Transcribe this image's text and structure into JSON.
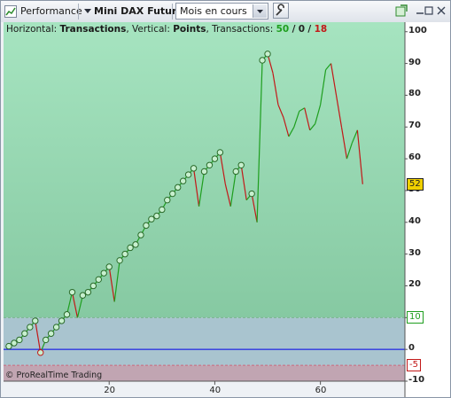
{
  "toolbar": {
    "perf_label": "Performance",
    "instrument_label": "Mini DAX Future",
    "period_value": "Mois en cours"
  },
  "info": {
    "prefix": "Horizontal: ",
    "h_value": "Transactions",
    "mid": ", Vertical: ",
    "v_value": "Points",
    "tx_label": ", Transactions: ",
    "wins": "50",
    "sep": "/",
    "neutral": "0",
    "losses": "18"
  },
  "copyright": "© ProRealTime Trading",
  "colors": {
    "win": "#1e9e1e",
    "loss": "#c21818",
    "neutral": "#222222",
    "current": "#f0d000",
    "baseline": "#0000e6"
  },
  "chart_data": {
    "type": "line",
    "xlim": [
      0,
      76
    ],
    "ylim": [
      -10,
      103
    ],
    "x_ticks": [
      20,
      40,
      60
    ],
    "y_ticks": [
      100,
      90,
      80,
      70,
      60,
      50,
      40,
      30,
      20,
      10,
      0,
      -10
    ],
    "current_value": 52,
    "upper_level": 10,
    "lower_level": -5,
    "baseline": 0,
    "x": [
      1,
      2,
      3,
      4,
      5,
      6,
      7,
      8,
      9,
      10,
      11,
      12,
      13,
      14,
      15,
      16,
      17,
      18,
      19,
      20,
      21,
      22,
      23,
      24,
      25,
      26,
      27,
      28,
      29,
      30,
      31,
      32,
      33,
      34,
      35,
      36,
      37,
      38,
      39,
      40,
      41,
      42,
      43,
      44,
      45,
      46,
      47,
      48,
      49,
      50,
      51,
      52,
      53,
      54,
      55,
      56,
      57,
      58,
      59,
      60,
      61,
      62,
      63,
      64,
      65,
      66,
      67,
      68
    ],
    "y": [
      1,
      2,
      3,
      5,
      7,
      9,
      -1,
      3,
      5,
      7,
      9,
      11,
      18,
      10,
      17,
      18,
      20,
      22,
      24,
      26,
      15,
      28,
      30,
      32,
      33,
      36,
      39,
      41,
      42,
      44,
      47,
      49,
      51,
      53,
      55,
      57,
      45,
      56,
      58,
      60,
      62,
      52,
      45,
      56,
      58,
      47,
      49,
      40,
      91,
      93,
      87,
      77,
      73,
      67,
      70,
      75,
      76,
      69,
      71,
      77,
      88,
      90,
      80,
      70,
      60,
      65,
      69,
      52
    ],
    "markers_until_x": 50
  }
}
